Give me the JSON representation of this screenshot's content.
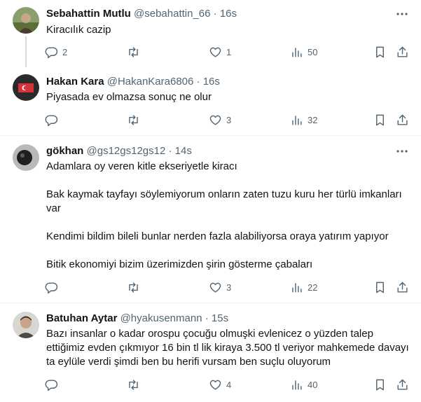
{
  "tweets": [
    {
      "name": "Sebahattin Mutlu",
      "handle": "@sebahattin_66",
      "time": "16s",
      "sep": "·",
      "paragraphs": [
        "Kiracılık cazip"
      ],
      "replies": "2",
      "retweets": "",
      "likes": "1",
      "views": "50"
    },
    {
      "name": "Hakan Kara",
      "handle": "@HakanKara6806",
      "time": "16s",
      "sep": "·",
      "paragraphs": [
        "Piyasada ev olmazsa sonuç ne olur"
      ],
      "replies": "",
      "retweets": "",
      "likes": "3",
      "views": "32"
    },
    {
      "name": "gökhan",
      "handle": "@gs12gs12gs12",
      "time": "14s",
      "sep": "·",
      "paragraphs": [
        "Adamlara oy veren kitle ekseriyetle kiracı",
        "Bak kaymak tayfayı söylemiyorum onların zaten tuzu kuru her türlü imkanları var",
        "Kendimi bildim bileli bunlar nerden fazla alabiliyorsa oraya yatırım yapıyor",
        "Bitik ekonomiyi bizim üzerimizden şirin gösterme çabaları"
      ],
      "replies": "",
      "retweets": "",
      "likes": "3",
      "views": "22"
    },
    {
      "name": "Batuhan Aytar",
      "handle": "@hyakusenmann",
      "time": "15s",
      "sep": "·",
      "paragraphs": [
        "Bazı insanlar o kadar orospu çocuğu olmuşki evlenicez o yüzden talep ettiğimiz evden çıkmıyor 16 bin tl lik kiraya 3.500 tl veriyor mahkemede davayı ta eylüle verdi şimdi ben bu herifi vursam ben suçlu oluyorum"
      ],
      "replies": "",
      "retweets": "",
      "likes": "4",
      "views": "40"
    }
  ],
  "icons": {
    "reply": "reply-icon",
    "retweet": "retweet-icon",
    "like": "heart-icon",
    "views": "views-icon",
    "bookmark": "bookmark-icon",
    "share": "share-icon",
    "more": "more-dots-icon"
  },
  "colors": {
    "text": "#0f1419",
    "secondary": "#536471",
    "divider": "#eff3f4",
    "thread_line": "#cfd9de"
  }
}
